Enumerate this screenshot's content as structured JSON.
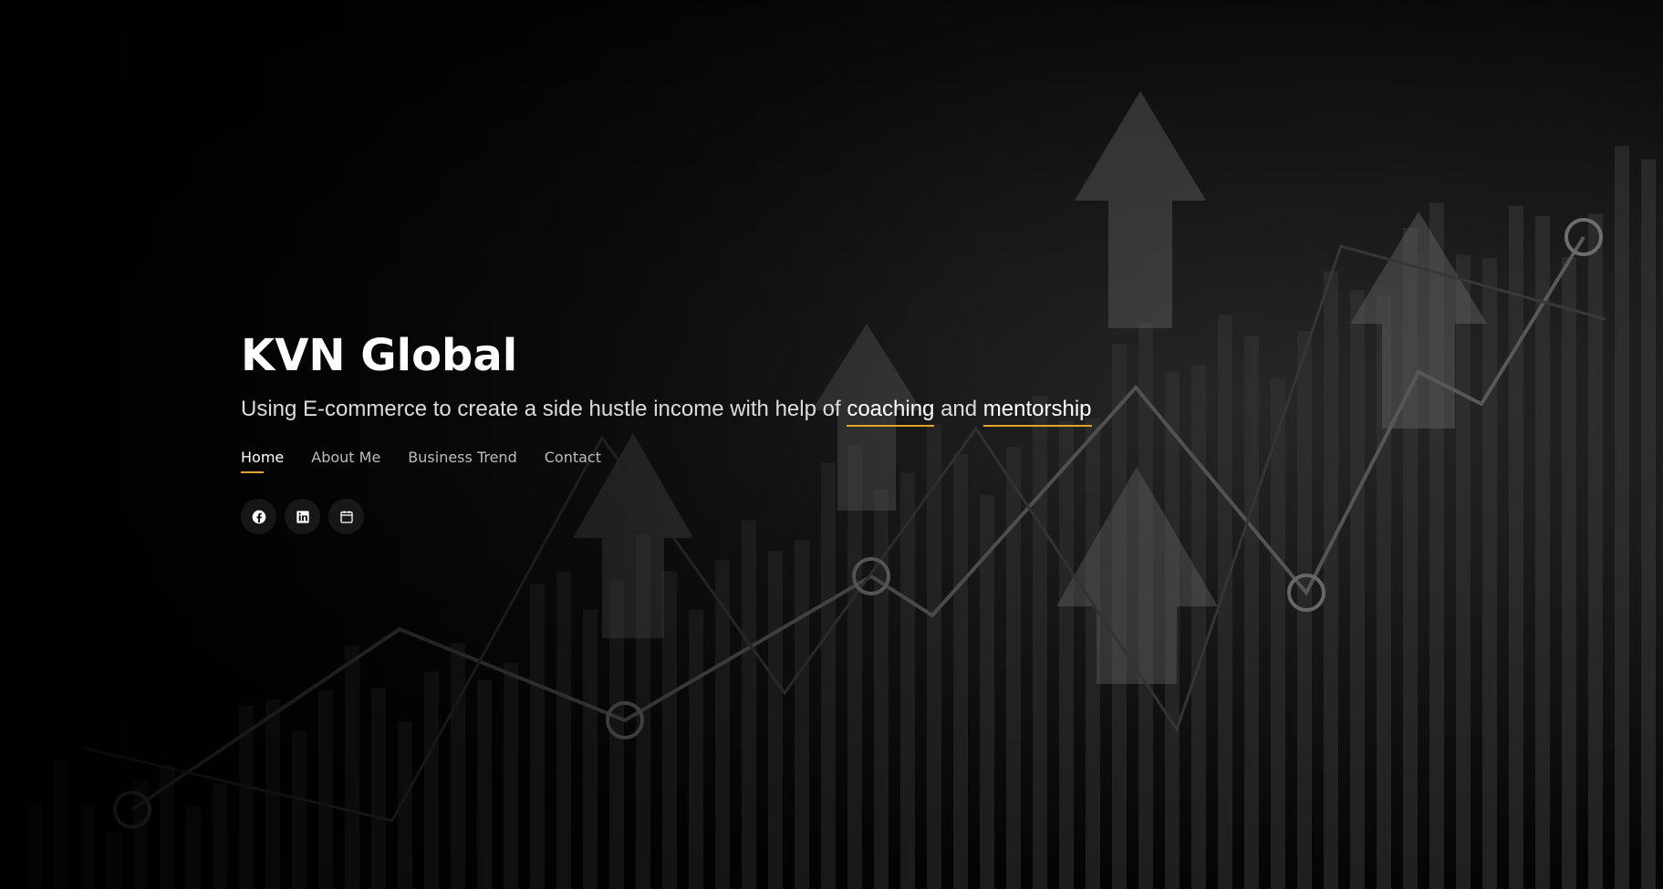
{
  "hero": {
    "title": "KVN Global",
    "subtitle_prefix": "Using E-commerce to create a side hustle income with help of",
    "typed_1": "coaching",
    "connector": "and",
    "typed_2": "mentorship"
  },
  "nav": {
    "items": [
      {
        "label": "Home",
        "active": true
      },
      {
        "label": "About Me",
        "active": false
      },
      {
        "label": "Business Trend",
        "active": false
      },
      {
        "label": "Contact",
        "active": false
      }
    ]
  },
  "social": {
    "icons": [
      "facebook-icon",
      "linkedin-icon",
      "calendar-icon"
    ]
  },
  "colors": {
    "accent": "#e2a32a",
    "background": "#000000",
    "text": "#ffffff"
  }
}
